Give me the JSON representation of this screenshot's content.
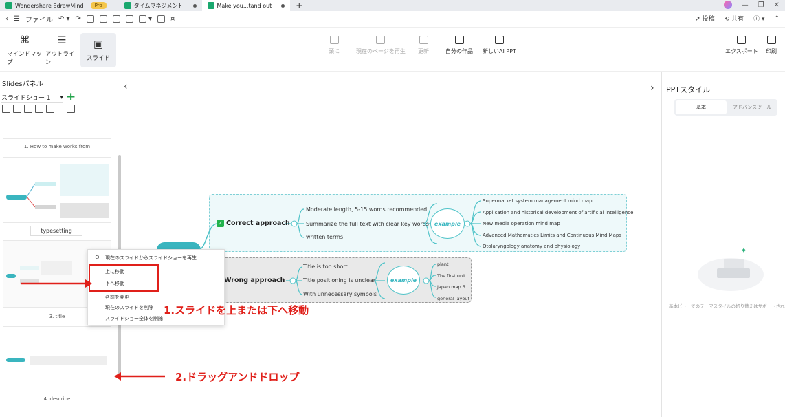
{
  "tabs": [
    {
      "label": "Wondershare EdrawMind",
      "badge": "Pro"
    },
    {
      "label": "タイムマネジメント"
    },
    {
      "label": "Make you...tand out"
    }
  ],
  "new_tab": "+",
  "quick_toolbar": {
    "file_label": "ファイル"
  },
  "top_right": {
    "share_label": "投稿",
    "collab_label": "共有",
    "help_label": "?"
  },
  "view_modes": [
    {
      "label": "マインドマップ",
      "icon": "mindmap-icon"
    },
    {
      "label": "アウトライン",
      "icon": "outline-icon"
    },
    {
      "label": "スライド",
      "icon": "slide-icon"
    }
  ],
  "slide_toolbar": [
    {
      "label": "頭に",
      "icon": "play-icon"
    },
    {
      "label": "現在のページを再生",
      "icon": "play-current-icon"
    },
    {
      "label": "更新",
      "icon": "refresh-icon"
    },
    {
      "label": "自分の作品",
      "icon": "my-works-icon"
    },
    {
      "label": "新しいAI PPT",
      "icon": "ai-ppt-icon"
    }
  ],
  "export": {
    "export_label": "エクスポート",
    "print_label": "印刷",
    "pdf_badge": "PDF"
  },
  "slides_panel": {
    "title": "Slidesパネル",
    "slideshow_select": "スライドショー 1",
    "captions": [
      "1. How to make works from",
      "typesetting",
      "3. title",
      "4. describe"
    ]
  },
  "ppt_style": {
    "title": "PPTスタイル",
    "tabs": [
      "基本",
      "アドバンスツール"
    ],
    "empty_message": "基本ビューでのテーマスタイルの切り替えはサポートされていません"
  },
  "mindmap": {
    "correct": {
      "title": "Correct approach",
      "points": [
        "Moderate length, 5-15 words recommended",
        "Summarize the full text with clear key words",
        "written terms"
      ],
      "example": "example",
      "examples": [
        "Supermarket system management mind map",
        "Application and historical development of artificial intelligence",
        "New media operation mind map",
        "Advanced Mathematics Limits and Continuous Mind Maps",
        "Otolaryngology anatomy and physiology"
      ]
    },
    "wrong": {
      "title": "Wrong approach",
      "points": [
        "Title is too short",
        "Title positioning is unclear",
        "With unnecessary symbols"
      ],
      "example": "example",
      "examples": [
        "plant",
        "The first unit",
        "Japan map 5",
        "general layout"
      ]
    }
  },
  "context_menu": {
    "items": [
      "現在のスライドからスライドショーを再生",
      "上に移動",
      "下へ移動",
      "名前を変更",
      "現在のスライドを削除",
      "スライドショー全体を削除"
    ]
  },
  "annotations": {
    "step1": "1.スライドを上または下へ移動",
    "step2": "2.ドラッグアンドドロップ"
  },
  "colors": {
    "accent_green": "#22b24c",
    "teal": "#4fc3c8",
    "annotation_red": "#e0201a"
  }
}
